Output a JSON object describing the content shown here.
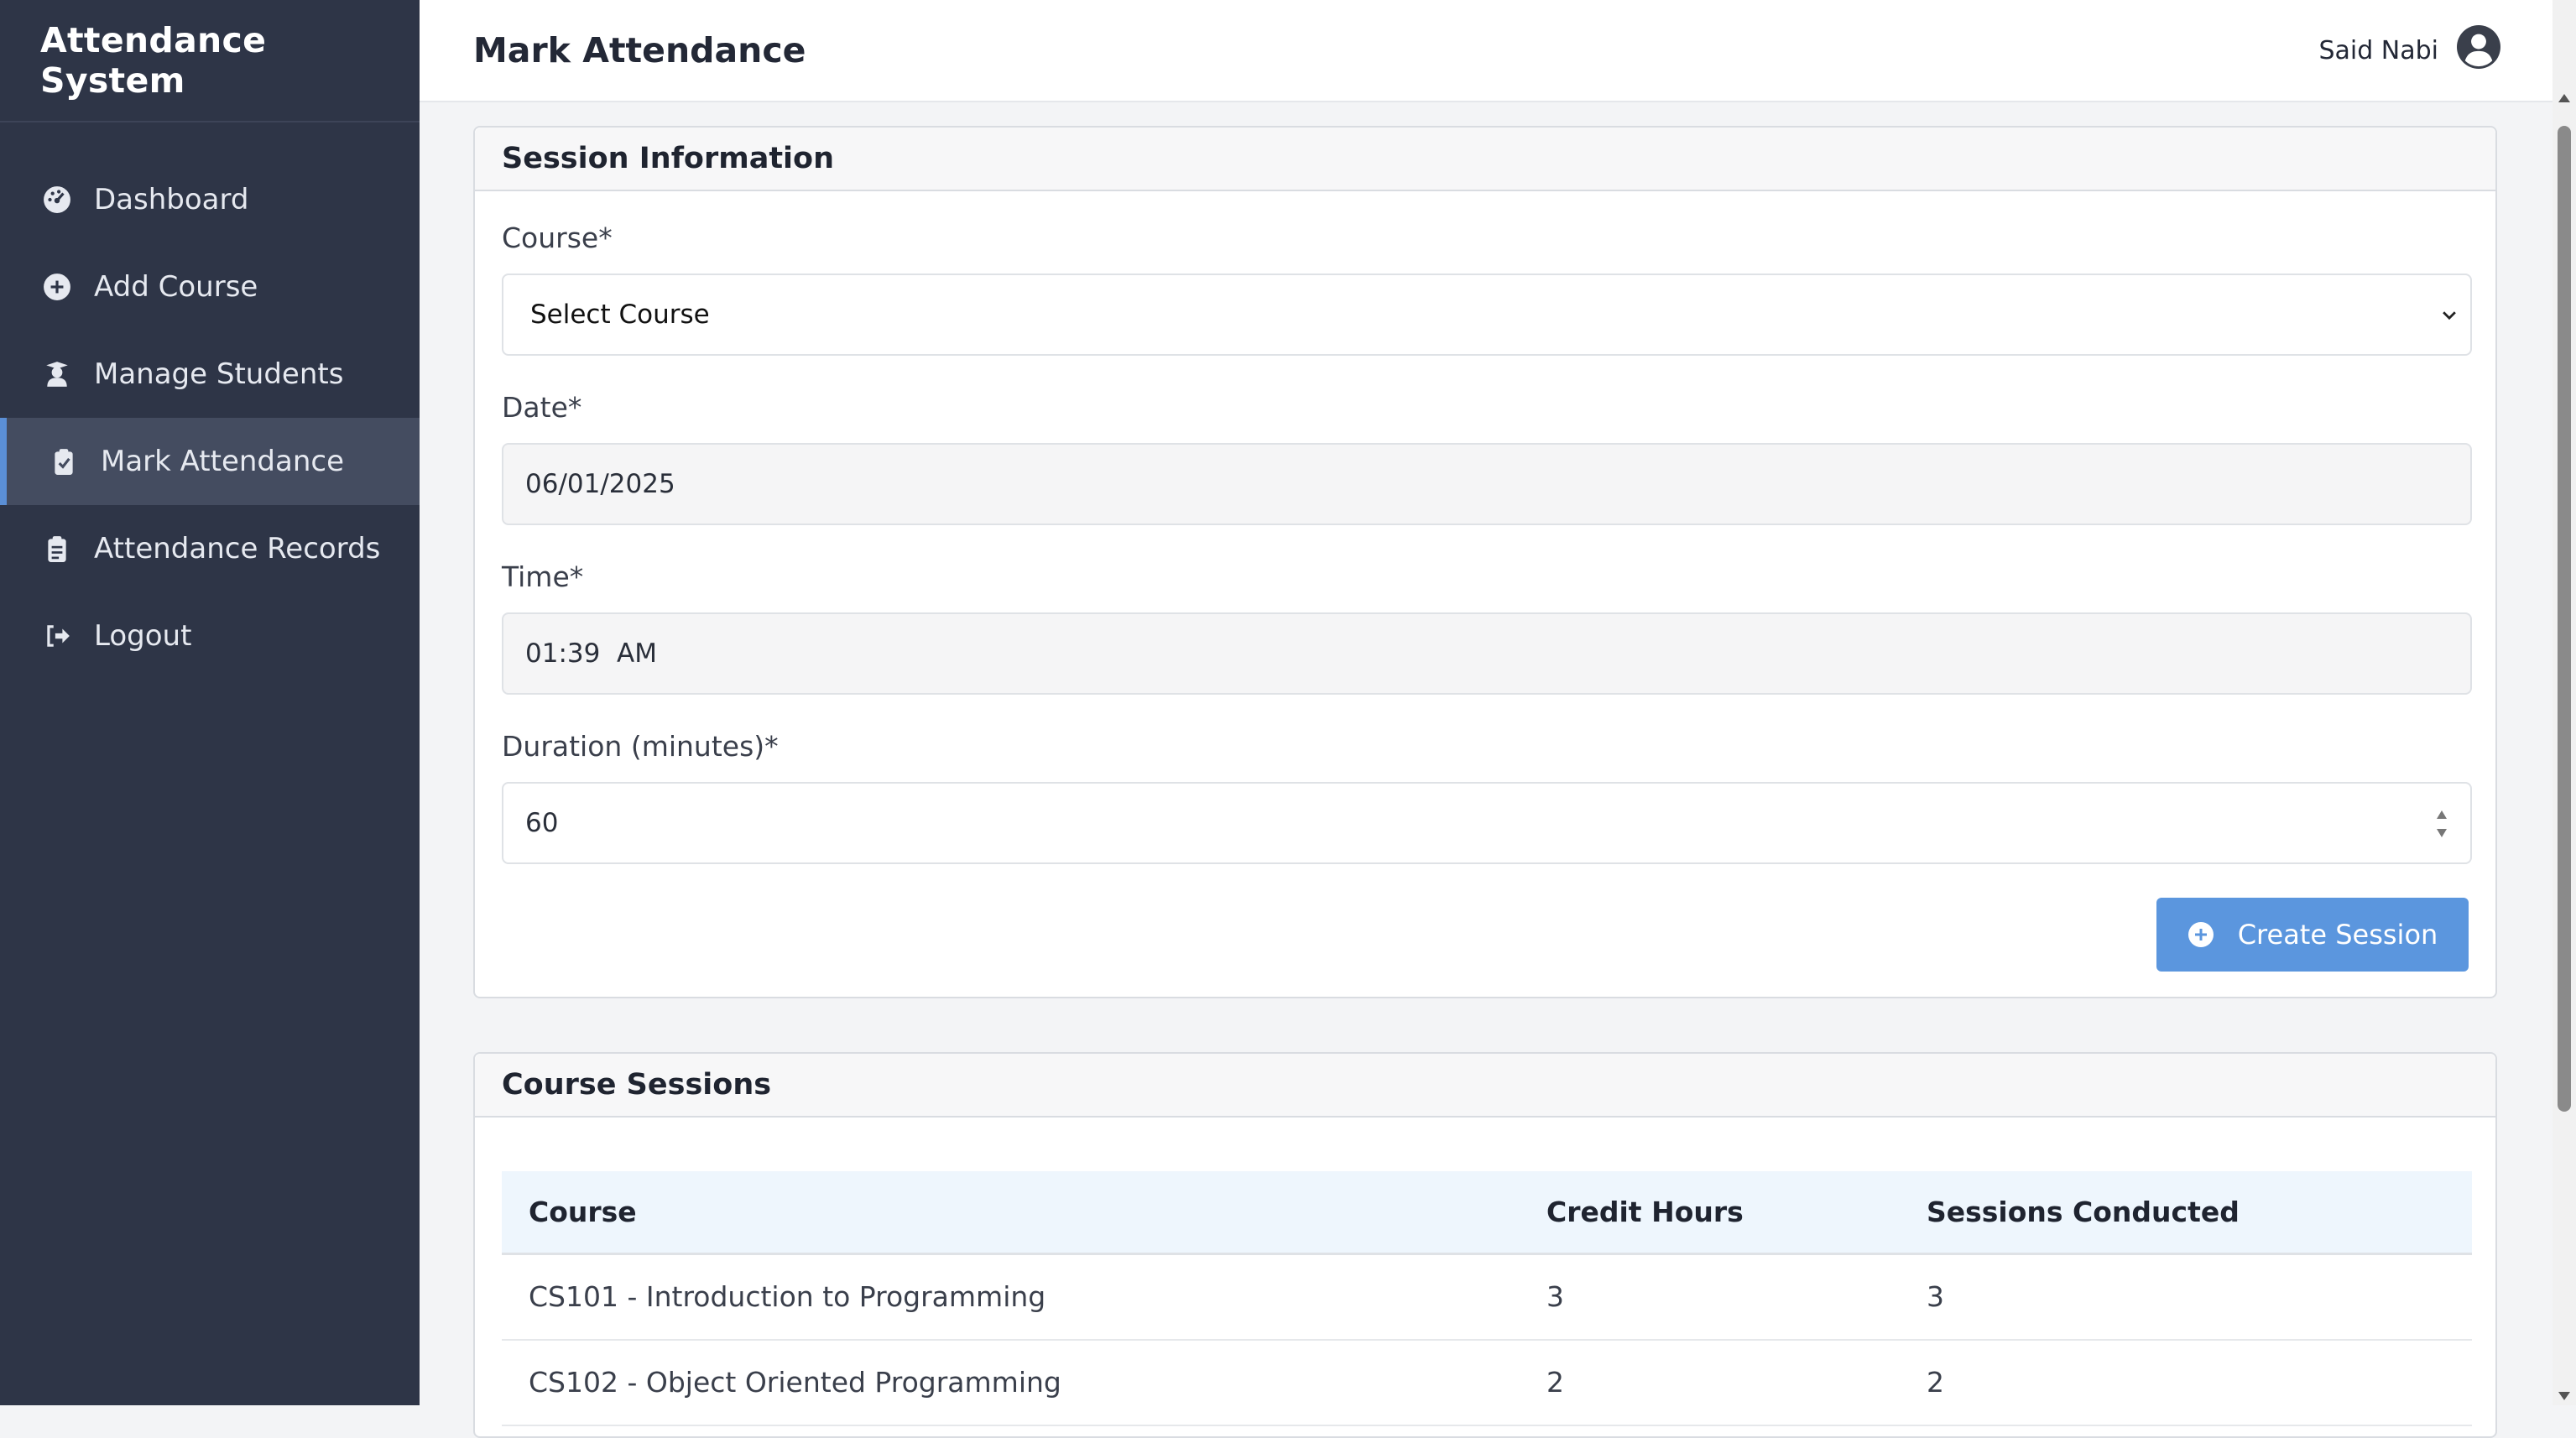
{
  "app": {
    "title": "Attendance System"
  },
  "sidebar": {
    "items": [
      {
        "label": "Dashboard",
        "icon": "gauge-icon"
      },
      {
        "label": "Add Course",
        "icon": "plus-circle-icon"
      },
      {
        "label": "Manage Students",
        "icon": "student-icon"
      },
      {
        "label": "Mark Attendance",
        "icon": "clipboard-check-icon",
        "active": true
      },
      {
        "label": "Attendance Records",
        "icon": "clipboard-list-icon"
      },
      {
        "label": "Logout",
        "icon": "logout-icon"
      }
    ]
  },
  "header": {
    "title": "Mark Attendance",
    "user_name": "Said Nabi"
  },
  "session_form": {
    "title": "Session Information",
    "course_label": "Course*",
    "course_value": "Select Course",
    "date_label": "Date*",
    "date_value": "06/01/2025",
    "time_label": "Time*",
    "time_value": "01:39  AM",
    "duration_label": "Duration (minutes)*",
    "duration_value": "60",
    "create_button": "Create Session"
  },
  "sessions": {
    "title": "Course Sessions",
    "columns": [
      "Course",
      "Credit Hours",
      "Sessions Conducted"
    ],
    "rows": [
      [
        "CS101 - Introduction to Programming",
        "3",
        "3"
      ],
      [
        "CS102 - Object Oriented Programming",
        "2",
        "2"
      ]
    ]
  },
  "colors": {
    "sidebar": "#2e3547",
    "accent": "#5b96de",
    "table_header": "#eef6fd"
  }
}
